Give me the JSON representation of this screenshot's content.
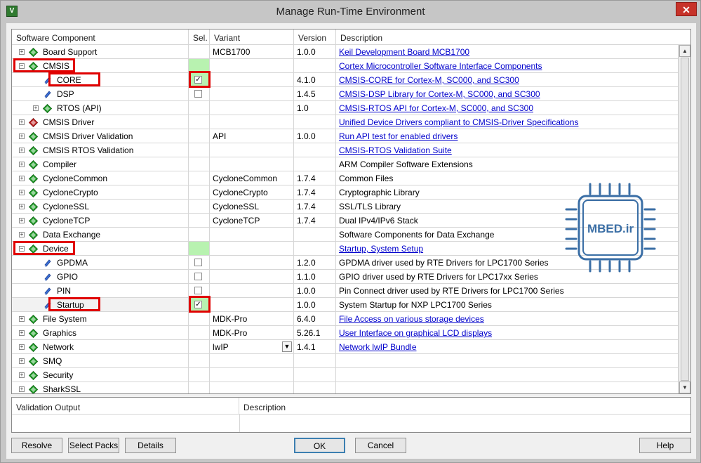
{
  "window": {
    "title": "Manage Run-Time Environment",
    "app_icon_letter": "V",
    "close_symbol": "✕"
  },
  "columns": {
    "component": "Software Component",
    "sel": "Sel.",
    "variant": "Variant",
    "version": "Version",
    "description": "Description"
  },
  "rows": [
    {
      "label": "Board Support",
      "level": 0,
      "expander": "+",
      "icon": "green-gem",
      "variant": "MCB1700",
      "version": "1.0.0",
      "description": "Keil Development Board MCB1700",
      "link": true
    },
    {
      "label": "CMSIS",
      "level": 0,
      "expander": "-",
      "icon": "green-gem",
      "sel_state": "green",
      "variant": "",
      "version": "",
      "description": "Cortex Microcontroller Software Interface Components",
      "link": true,
      "highlighted": true
    },
    {
      "label": "CORE",
      "level": 1,
      "expander": "",
      "icon": "blue-gem",
      "checkbox": true,
      "checked": true,
      "sel_state": "green",
      "variant": "",
      "version": "4.1.0",
      "description": "CMSIS-CORE for Cortex-M, SC000, and SC300",
      "link": true,
      "highlighted": true,
      "checkbox_highlighted": true
    },
    {
      "label": "DSP",
      "level": 1,
      "expander": "",
      "icon": "blue-gem",
      "checkbox": true,
      "checked": false,
      "variant": "",
      "version": "1.4.5",
      "description": "CMSIS-DSP Library for Cortex-M, SC000, and SC300",
      "link": true
    },
    {
      "label": "RTOS (API)",
      "level": 1,
      "expander": "+",
      "icon": "green-gem",
      "variant": "",
      "version": "1.0",
      "description": "CMSIS-RTOS API for Cortex-M, SC000, and SC300",
      "link": true
    },
    {
      "label": "CMSIS Driver",
      "level": 0,
      "expander": "+",
      "icon": "red-gem",
      "variant": "",
      "version": "",
      "description": "Unified Device Drivers compliant to CMSIS-Driver Specifications",
      "link": true
    },
    {
      "label": "CMSIS Driver Validation",
      "level": 0,
      "expander": "+",
      "icon": "green-gem",
      "variant": "API",
      "version": "1.0.0",
      "description": "Run API test for enabled drivers",
      "link": true
    },
    {
      "label": "CMSIS RTOS Validation",
      "level": 0,
      "expander": "+",
      "icon": "green-gem",
      "variant": "",
      "version": "",
      "description": "CMSIS-RTOS Validation Suite",
      "link": true
    },
    {
      "label": "Compiler",
      "level": 0,
      "expander": "+",
      "icon": "green-gem",
      "variant": "",
      "version": "",
      "description": "ARM Compiler Software Extensions",
      "link": false
    },
    {
      "label": "CycloneCommon",
      "level": 0,
      "expander": "+",
      "icon": "green-gem",
      "variant": "CycloneCommon",
      "version": "1.7.4",
      "description": "Common Files",
      "link": false
    },
    {
      "label": "CycloneCrypto",
      "level": 0,
      "expander": "+",
      "icon": "green-gem",
      "variant": "CycloneCrypto",
      "version": "1.7.4",
      "description": "Cryptographic Library",
      "link": false
    },
    {
      "label": "CycloneSSL",
      "level": 0,
      "expander": "+",
      "icon": "green-gem",
      "variant": "CycloneSSL",
      "version": "1.7.4",
      "description": "SSL/TLS Library",
      "link": false
    },
    {
      "label": "CycloneTCP",
      "level": 0,
      "expander": "+",
      "icon": "green-gem",
      "variant": "CycloneTCP",
      "version": "1.7.4",
      "description": "Dual IPv4/IPv6 Stack",
      "link": false
    },
    {
      "label": "Data Exchange",
      "level": 0,
      "expander": "+",
      "icon": "green-gem",
      "variant": "",
      "version": "",
      "description": "Software Components for Data Exchange",
      "link": false
    },
    {
      "label": "Device",
      "level": 0,
      "expander": "-",
      "icon": "green-gem",
      "sel_state": "green",
      "variant": "",
      "version": "",
      "description": "Startup, System Setup",
      "link": true,
      "highlighted": true
    },
    {
      "label": "GPDMA",
      "level": 1,
      "expander": "",
      "icon": "blue-gem",
      "checkbox": true,
      "checked": false,
      "variant": "",
      "version": "1.2.0",
      "description": "GPDMA driver used by RTE Drivers for LPC1700 Series",
      "link": false
    },
    {
      "label": "GPIO",
      "level": 1,
      "expander": "",
      "icon": "blue-gem",
      "checkbox": true,
      "checked": false,
      "variant": "",
      "version": "1.1.0",
      "description": "GPIO driver used by RTE Drivers for LPC17xx Series",
      "link": false
    },
    {
      "label": "PIN",
      "level": 1,
      "expander": "",
      "icon": "blue-gem",
      "checkbox": true,
      "checked": false,
      "variant": "",
      "version": "1.0.0",
      "description": "Pin Connect driver used by RTE Drivers for LPC1700 Series",
      "link": false
    },
    {
      "label": "Startup",
      "level": 1,
      "expander": "",
      "icon": "blue-gem",
      "checkbox": true,
      "checked": true,
      "sel_state": "green",
      "variant": "",
      "version": "1.0.0",
      "description": "System Startup for NXP LPC1700 Series",
      "link": false,
      "highlighted": true,
      "checkbox_highlighted": true,
      "selected_row": true
    },
    {
      "label": "File System",
      "level": 0,
      "expander": "+",
      "icon": "green-gem",
      "variant": "MDK-Pro",
      "version": "6.4.0",
      "description": "File Access on various storage devices",
      "link": true
    },
    {
      "label": "Graphics",
      "level": 0,
      "expander": "+",
      "icon": "green-gem",
      "variant": "MDK-Pro",
      "version": "5.26.1",
      "description": "User Interface on graphical LCD displays",
      "link": true
    },
    {
      "label": "Network",
      "level": 0,
      "expander": "+",
      "icon": "green-gem",
      "variant": "lwIP",
      "variant_dropdown": true,
      "version": "1.4.1",
      "description": "Network lwIP Bundle",
      "link": true
    },
    {
      "label": "SMQ",
      "level": 0,
      "expander": "+",
      "icon": "green-gem",
      "variant": "",
      "version": "",
      "description": "",
      "link": false
    },
    {
      "label": "Security",
      "level": 0,
      "expander": "+",
      "icon": "green-gem",
      "variant": "",
      "version": "",
      "description": "",
      "link": false
    },
    {
      "label": "SharkSSL",
      "level": 0,
      "expander": "+",
      "icon": "green-gem",
      "variant": "",
      "version": "",
      "description": "",
      "link": false
    }
  ],
  "validation": {
    "output_header": "Validation Output",
    "description_header": "Description"
  },
  "buttons": {
    "resolve": "Resolve",
    "select_packs": "Select Packs",
    "details": "Details",
    "ok": "OK",
    "cancel": "Cancel",
    "help": "Help"
  },
  "watermark": {
    "text": "MBED.ir",
    "color": "#3a6ea5"
  },
  "colors": {
    "highlight_box": "#e00000",
    "selection_green": "#b8f2b0",
    "link": "#0000cc"
  }
}
